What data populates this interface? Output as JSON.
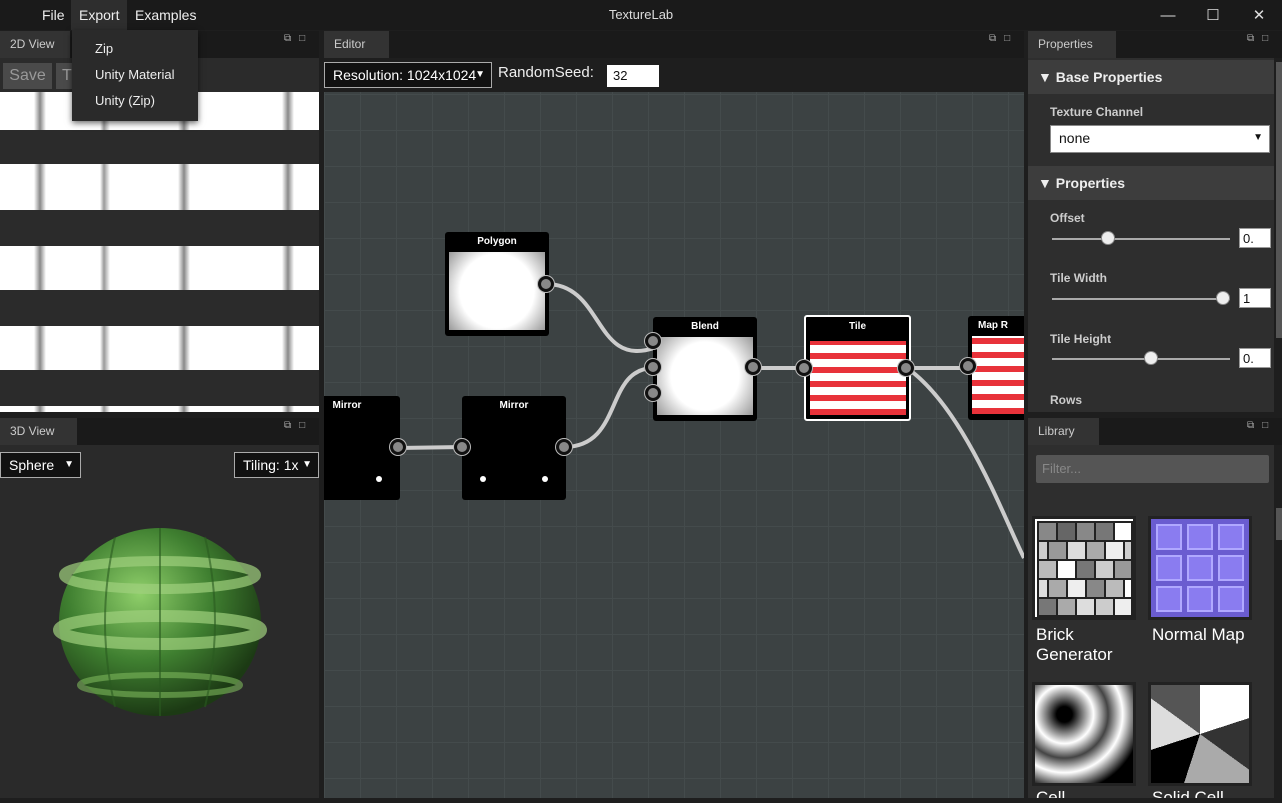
{
  "app": {
    "title": "TextureLab",
    "menu": [
      "File",
      "Export",
      "Examples"
    ],
    "export_menu": [
      "Zip",
      "Unity Material",
      "Unity (Zip)"
    ]
  },
  "view2d": {
    "tab": "2D View",
    "save": "Save",
    "t": "T"
  },
  "view3d": {
    "tab": "3D View",
    "shape": "Sphere",
    "tiling": "Tiling: 1x"
  },
  "editor": {
    "tab": "Editor",
    "resolution": "Resolution: 1024x1024",
    "seed_label": "RandomSeed:",
    "seed_value": "32",
    "nodes": {
      "polygon": "Polygon",
      "mirror1": "Mirror",
      "mirror2": "Mirror",
      "blend": "Blend",
      "tile": "Tile",
      "map": "Map R"
    }
  },
  "properties": {
    "tab": "Properties",
    "base_header": "Base Properties",
    "texture_channel_label": "Texture Channel",
    "texture_channel_value": "none",
    "props_header": "Properties",
    "offset_label": "Offset",
    "offset_value": "0.",
    "tile_width_label": "Tile Width",
    "tile_width_value": "1",
    "tile_height_label": "Tile Height",
    "tile_height_value": "0.",
    "rows_label": "Rows"
  },
  "library": {
    "tab": "Library",
    "filter_placeholder": "Filter...",
    "items": [
      "Brick Generator",
      "Normal Map",
      "Cell",
      "Solid Cell"
    ]
  },
  "colors": {
    "accent_red": "#e8323a",
    "normal_map": "#8a7cf0",
    "sphere_green": "#4a8a3a"
  }
}
